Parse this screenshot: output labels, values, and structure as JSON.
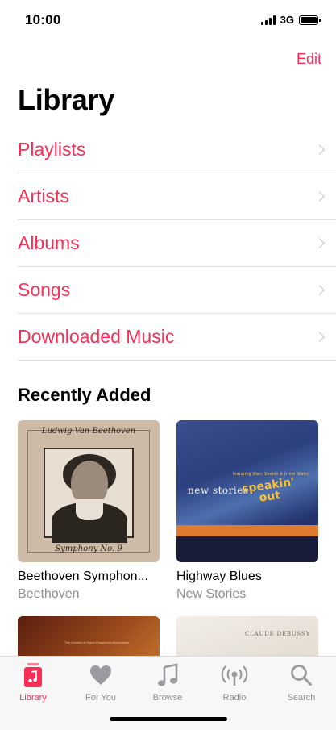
{
  "status_bar": {
    "time": "10:00",
    "network": "3G"
  },
  "header": {
    "edit_label": "Edit",
    "title": "Library"
  },
  "nav_items": [
    {
      "label": "Playlists"
    },
    {
      "label": "Artists"
    },
    {
      "label": "Albums"
    },
    {
      "label": "Songs"
    },
    {
      "label": "Downloaded Music"
    }
  ],
  "recently_added": {
    "title": "Recently Added",
    "albums": [
      {
        "name": "Beethoven Symphon...",
        "artist": "Beethoven",
        "art_text_top": "Ludwig Van Beethoven",
        "art_text_bottom": "Symphony No. 9"
      },
      {
        "name": "Highway Blues",
        "artist": "New Stories",
        "art_text_main": "new stories",
        "art_text_accent_1": "speakin'",
        "art_text_accent_2": "out",
        "art_text_small": "featuring Marc Seales & Ernie Watts"
      },
      {
        "art_text": "The Vocalist of Hyper Polyphonic Movements"
      },
      {
        "art_text": "CLAUDE DEBUSSY"
      }
    ]
  },
  "tab_bar": {
    "tabs": [
      {
        "label": "Library",
        "icon": "library-icon",
        "active": true
      },
      {
        "label": "For You",
        "icon": "heart-icon",
        "active": false
      },
      {
        "label": "Browse",
        "icon": "music-note-icon",
        "active": false
      },
      {
        "label": "Radio",
        "icon": "radio-icon",
        "active": false
      },
      {
        "label": "Search",
        "icon": "search-icon",
        "active": false
      }
    ]
  },
  "colors": {
    "accent": "#fa2d55",
    "secondary_text": "#8e8e93",
    "separator": "#e2e2e6"
  }
}
